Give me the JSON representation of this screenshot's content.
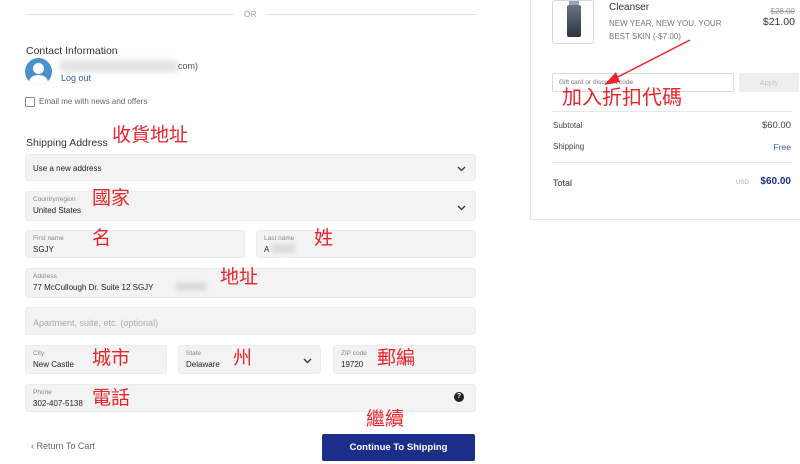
{
  "divider": {
    "or_text": "OR"
  },
  "contact": {
    "heading": "Contact Information",
    "email_suffix": "com)",
    "logout": "Log out",
    "newsletter_label": "Email me with news and offers"
  },
  "shipping": {
    "heading": "Shipping Address",
    "saved_address": "Use a new address",
    "country": {
      "label": "Country/region",
      "value": "United States"
    },
    "first_name": {
      "label": "First name",
      "value": "SGJY"
    },
    "last_name": {
      "label": "Last name",
      "value": "A"
    },
    "address": {
      "label": "Address",
      "value": "77 McCullough Dr. Suite 12 SGJY"
    },
    "apartment": {
      "placeholder": "Apartment, suite, etc. (optional)"
    },
    "city": {
      "label": "City",
      "value": "New Castle"
    },
    "state": {
      "label": "State",
      "value": "Delaware"
    },
    "zip": {
      "label": "ZIP code",
      "value": "19720"
    },
    "phone": {
      "label": "Phone",
      "value": "302-407-5138"
    },
    "help_icon_glyph": "?"
  },
  "actions": {
    "return_chevron": "‹",
    "return_label": "Return To Cart",
    "continue_label": "Continue To Shipping"
  },
  "annotations": {
    "shipping_address": "收貨地址",
    "country": "國家",
    "first_name": "名",
    "last_name": "姓",
    "address": "地址",
    "city": "城市",
    "state": "州",
    "zip": "郵編",
    "phone": "電話",
    "continue": "繼續",
    "discount_code": "加入折扣代碼"
  },
  "summary": {
    "product": {
      "name": "Cleanser",
      "promo": "NEW YEAR, NEW YOU. YOUR BEST SKIN (-$7.00)",
      "price_old": "$28.00",
      "price_new": "$21.00"
    },
    "gift_placeholder": "Gift card or discount code",
    "apply_label": "Apply",
    "subtotal_label": "Subtotal",
    "subtotal_value": "$60.00",
    "shipping_label": "Shipping",
    "shipping_value": "Free",
    "total_label": "Total",
    "currency": "USD",
    "total_value": "$60.00"
  },
  "icons": {
    "avatar": "user-avatar-icon",
    "select_chevron": "chevron-down-icon",
    "help": "question-circle-icon",
    "product_image": "cleanser-bottle-icon"
  },
  "colors": {
    "primary_button": "#1b2e8a",
    "link": "#3a5b9a",
    "annotation": "#e8242c",
    "avatar": "#4a90c9"
  }
}
